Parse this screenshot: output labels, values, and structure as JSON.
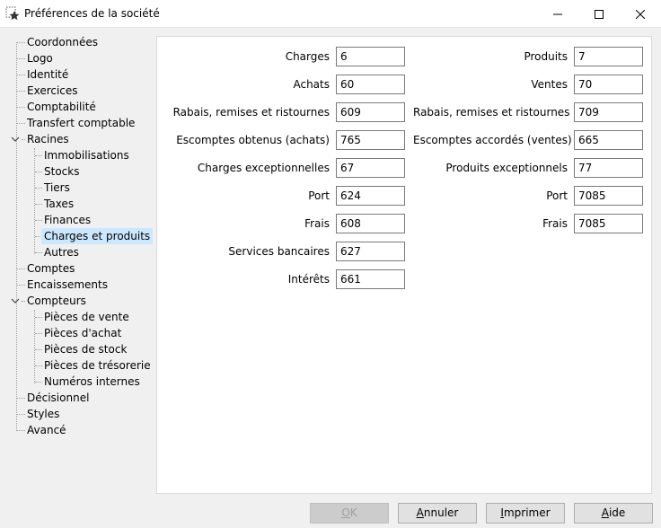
{
  "window": {
    "title": "Préférences de la société",
    "icon": "gear-star-icon",
    "controls": [
      "minimize-icon",
      "maximize-icon",
      "close-icon"
    ]
  },
  "tree": {
    "items": [
      {
        "label": "Coordonnées"
      },
      {
        "label": "Logo"
      },
      {
        "label": "Identité"
      },
      {
        "label": "Exercices"
      },
      {
        "label": "Comptabilité"
      },
      {
        "label": "Transfert comptable"
      },
      {
        "label": "Racines",
        "expanded": true
      },
      {
        "label": "Immobilisations"
      },
      {
        "label": "Stocks"
      },
      {
        "label": "Tiers"
      },
      {
        "label": "Taxes"
      },
      {
        "label": "Finances"
      },
      {
        "label": "Charges et produits",
        "selected": true
      },
      {
        "label": "Autres"
      },
      {
        "label": "Comptes"
      },
      {
        "label": "Encaissements"
      },
      {
        "label": "Compteurs",
        "expanded": true
      },
      {
        "label": "Pièces de vente"
      },
      {
        "label": "Pièces d'achat"
      },
      {
        "label": "Pièces de stock"
      },
      {
        "label": "Pièces de trésorerie"
      },
      {
        "label": "Numéros internes"
      },
      {
        "label": "Décisionnel"
      },
      {
        "label": "Styles"
      },
      {
        "label": "Avancé"
      }
    ]
  },
  "charges": [
    {
      "label": "Charges",
      "value": "6"
    },
    {
      "label": "Achats",
      "value": "60"
    },
    {
      "label": "Rabais, remises et ristournes",
      "value": "609"
    },
    {
      "label": "Escomptes obtenus (achats)",
      "value": "765"
    },
    {
      "label": "Charges exceptionnelles",
      "value": "67"
    },
    {
      "label": "Port",
      "value": "624"
    },
    {
      "label": "Frais",
      "value": "608"
    },
    {
      "label": "Services bancaires",
      "value": "627"
    },
    {
      "label": "Intérêts",
      "value": "661"
    }
  ],
  "produits": [
    {
      "label": "Produits",
      "value": "7"
    },
    {
      "label": "Ventes",
      "value": "70"
    },
    {
      "label": "Rabais, remises et ristournes",
      "value": "709"
    },
    {
      "label": "Escomptes accordés (ventes)",
      "value": "665"
    },
    {
      "label": "Produits exceptionnels",
      "value": "77"
    },
    {
      "label": "Port",
      "value": "7085"
    },
    {
      "label": "Frais",
      "value": "7085"
    }
  ],
  "buttons": {
    "ok": {
      "first": "O",
      "rest": "K",
      "disabled": true
    },
    "annuler": {
      "first": "A",
      "rest": "nnuler"
    },
    "imprimer": {
      "first": "I",
      "rest": "mprimer"
    },
    "aide": {
      "first": "A",
      "rest": "ide"
    }
  }
}
